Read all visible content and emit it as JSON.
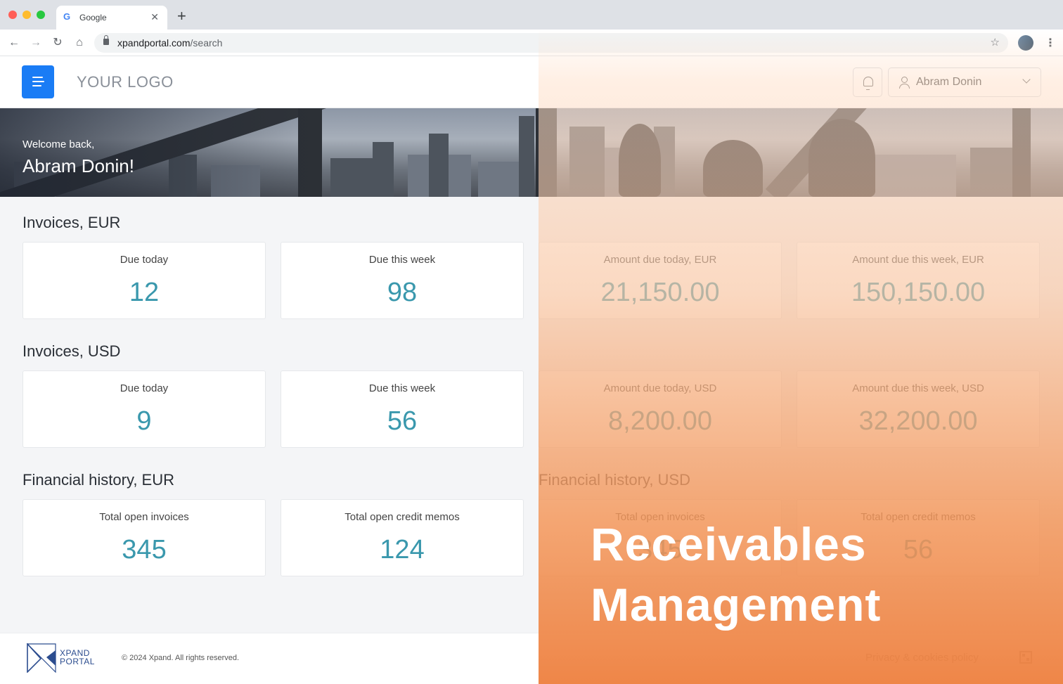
{
  "browser": {
    "tab_title": "Google",
    "tab_favicon": "G",
    "url_host": "xpandportal.com",
    "url_path": "/search"
  },
  "header": {
    "logo_text": "YOUR LOGO",
    "user_name": "Abram Donin"
  },
  "hero": {
    "welcome_sub": "Welcome back,",
    "welcome_name": "Abram Donin!"
  },
  "sections": {
    "invoices_eur": {
      "title": "Invoices, EUR",
      "cards": [
        {
          "label": "Due today",
          "value": "12"
        },
        {
          "label": "Due this week",
          "value": "98"
        },
        {
          "label": "Amount due today, EUR",
          "value": "21,150.00"
        },
        {
          "label": "Amount due this week, EUR",
          "value": "150,150.00"
        }
      ]
    },
    "invoices_usd": {
      "title": "Invoices, USD",
      "cards": [
        {
          "label": "Due today",
          "value": "9"
        },
        {
          "label": "Due this week",
          "value": "56"
        },
        {
          "label": "Amount due today, USD",
          "value": "8,200.00"
        },
        {
          "label": "Amount due this week, USD",
          "value": "32,200.00"
        }
      ]
    },
    "history_eur": {
      "title": "Financial history, EUR",
      "cards": [
        {
          "label": "Total open invoices",
          "value": "345"
        },
        {
          "label": "Total open credit memos",
          "value": "124"
        }
      ]
    },
    "history_usd": {
      "title": "Financial history, USD",
      "cards": [
        {
          "label": "Total open invoices",
          "value": "345"
        },
        {
          "label": "Total open credit memos",
          "value": "56"
        }
      ]
    }
  },
  "footer": {
    "brand_line1": "XPAND",
    "brand_line2": "PORTAL",
    "copyright": "© 2024 Xpand. All rights reserved.",
    "privacy_link": "Privacy & cookies policy"
  },
  "promo": {
    "line1": "Receivables",
    "line2": "Management"
  },
  "colors": {
    "accent": "#1a7cf5",
    "value_teal": "#3a98ad",
    "promo_orange": "#ee8242"
  }
}
